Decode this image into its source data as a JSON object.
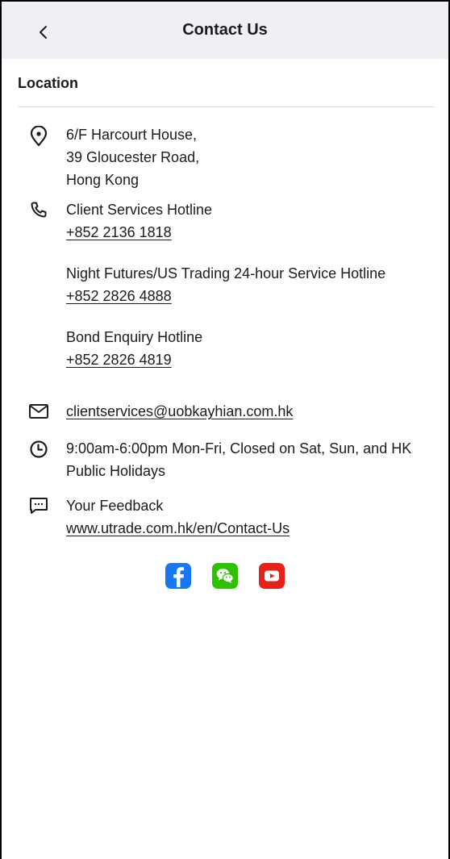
{
  "header": {
    "title": "Contact Us"
  },
  "section": {
    "title": "Location"
  },
  "address": {
    "line1": "6/F Harcourt House,",
    "line2": "39 Gloucester Road,",
    "line3": "Hong Kong"
  },
  "phones": {
    "client_label": "Client Services Hotline",
    "client_number": "+852 2136 1818",
    "night_label": "Night Futures/US Trading 24-hour Service Hotline",
    "night_number": "+852 2826 4888",
    "bond_label": "Bond Enquiry Hotline",
    "bond_number": "+852 2826 4819"
  },
  "email": {
    "address": "clientservices@uobkayhian.com.hk"
  },
  "hours": {
    "text": "9:00am-6:00pm Mon-Fri, Closed on Sat, Sun, and HK Public Holidays"
  },
  "feedback": {
    "label": "Your Feedback",
    "url": "www.utrade.com.hk/en/Contact-Us"
  },
  "social": {
    "icons": [
      "facebook-icon",
      "wechat-icon",
      "youtube-icon"
    ],
    "colors": {
      "facebook": "#1877f2",
      "wechat": "#2dc100",
      "youtube": "#e62117"
    }
  },
  "colors": {
    "header_bg": "#eef0f3",
    "text": "#1c1c1e",
    "divider": "#dcdfe3"
  }
}
